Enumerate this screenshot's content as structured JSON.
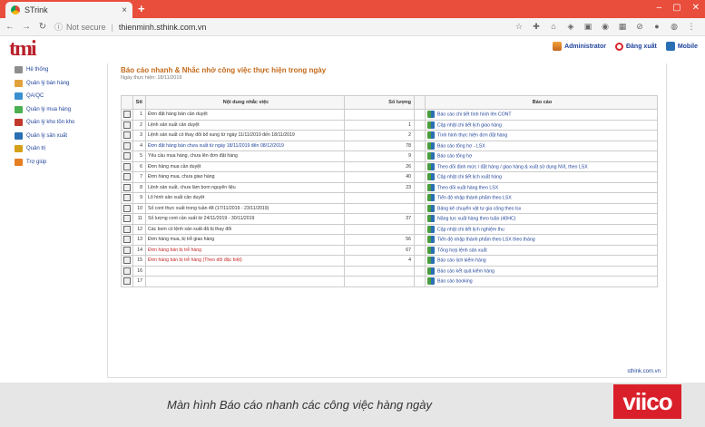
{
  "browser": {
    "tab_title": "STrink",
    "tab_close": "×",
    "new_tab": "+",
    "window_controls": [
      "–",
      "▢",
      "✕"
    ],
    "security": "Not secure",
    "url": "thienminh.sthink.com.vn"
  },
  "header": {
    "logo_text": "tmi",
    "user": "Administrator",
    "logout": "Đăng xuất",
    "mobile": "Mobile"
  },
  "sidebar": {
    "items": [
      {
        "label": "Hệ thống",
        "icon": "tools-icon",
        "color": "#8e8e8e"
      },
      {
        "label": "Quản lý bán hàng",
        "icon": "sales-icon",
        "color": "#e2a23b"
      },
      {
        "label": "QA/QC",
        "icon": "chart-icon",
        "color": "#3a8fd1"
      },
      {
        "label": "Quản lý mua hàng",
        "icon": "cart-icon",
        "color": "#4caf50"
      },
      {
        "label": "Quản lý kho tồn kho",
        "icon": "warehouse-icon",
        "color": "#c0392b"
      },
      {
        "label": "Quản lý sản xuất",
        "icon": "factory-icon",
        "color": "#2a6fb3"
      },
      {
        "label": "Quản trị",
        "icon": "admin-icon",
        "color": "#d4a017"
      },
      {
        "label": "Trợ giúp",
        "icon": "help-icon",
        "color": "#e67e22"
      }
    ]
  },
  "main": {
    "title": "Báo cáo nhanh & Nhắc nhở công việc thực hiện trong ngày",
    "date": "Ngày thực hiện: 18/11/2019",
    "headers": {
      "stt": "Stt",
      "job": "Nội dung nhắc việc",
      "qty": "Số lượng",
      "report": "Báo cáo"
    },
    "rows": [
      {
        "stt": "1",
        "job": "Đơn đặt hàng bán cần duyệt",
        "qty": "",
        "style": "plain",
        "report": "Báo cáo chi tiết tình hình lên CONT"
      },
      {
        "stt": "2",
        "job": "Lệnh sản xuất cần duyệt",
        "qty": "1",
        "style": "plain",
        "report": "Cập nhật chi tiết lịch giao hàng"
      },
      {
        "stt": "3",
        "job": "Lệnh sản xuất có thay đổi bổ sung từ ngày 11/11/2019 đến 18/11/2019",
        "qty": "2",
        "style": "plain",
        "report": "Tình hình thực hiện đơn đặt hàng"
      },
      {
        "stt": "4",
        "job": "Đơn đặt hàng bán chưa xuất từ ngày 18/11/2019 đến 08/12/2019",
        "qty": "78",
        "style": "link",
        "report": "Báo cáo tổng hợ - LSX"
      },
      {
        "stt": "5",
        "job": "Yêu cầu mua hàng, chưa lên đơn đặt hàng",
        "qty": "9",
        "style": "plain",
        "report": "Báo cáo tổng hợ"
      },
      {
        "stt": "6",
        "job": "Đơn hàng mua cần duyệt",
        "qty": "26",
        "style": "plain",
        "report": "Theo dõi định mức / đặt hàng / giao hàng & xuất sử dụng NVL theo LSX"
      },
      {
        "stt": "7",
        "job": "Đơn hàng mua, chưa giao hàng",
        "qty": "40",
        "style": "plain",
        "report": "Cập nhật chi tiết lịch xuất hàng"
      },
      {
        "stt": "8",
        "job": "Lệnh sản xuất, chưa làm bom nguyên liệu",
        "qty": "23",
        "style": "plain",
        "report": "Theo dõi xuất hàng theo LSX"
      },
      {
        "stt": "9",
        "job": "Lô hình sản xuất cần duyệt",
        "qty": "",
        "style": "plain",
        "report": "Tiến độ nhập thành phẩm theo LSX"
      },
      {
        "stt": "10",
        "job": "Số cont thực xuất trong tuần 48 (17/11/2019 - 23/11/2019)",
        "qty": "",
        "style": "plain",
        "report": "Bảng kê chuyển vật tư gia công theo lsx"
      },
      {
        "stt": "11",
        "job": "Số lượng cont cần xuất từ 24/11/2019 - 30/11/2019",
        "qty": "37",
        "style": "plain",
        "report": "Năng lực xuất hàng theo tuần (40HC)"
      },
      {
        "stt": "12",
        "job": "Các bom có lệnh sản xuất đã bị thay đổi",
        "qty": "",
        "style": "plain",
        "report": "Cập nhật chi tiết lịch nghiệm thu"
      },
      {
        "stt": "13",
        "job": "Đơn hàng mua, bị trễ giao hàng",
        "qty": "56",
        "style": "plain",
        "report": "Tiến độ nhập thành phẩm theo LSX theo tháng"
      },
      {
        "stt": "14",
        "job": "Đơn hàng bán bị trễ hàng",
        "qty": "67",
        "style": "red",
        "report": "Tổng hợp lệnh sản xuất"
      },
      {
        "stt": "15",
        "job": "Đơn hàng bán bị trễ hàng (Theo dõi đặc biệt)",
        "qty": "4",
        "style": "red",
        "report": "Báo cáo lịch kiểm hàng"
      },
      {
        "stt": "16",
        "job": "",
        "qty": "",
        "style": "plain",
        "report": "Báo cáo kết quả kiểm hàng"
      },
      {
        "stt": "17",
        "job": "",
        "qty": "",
        "style": "plain",
        "report": "Báo cáo booking"
      }
    ],
    "signature": "sthink.com.vn"
  },
  "caption": {
    "text": "Màn hình Báo cáo nhanh các công việc hàng ngày",
    "brand": "viico"
  }
}
